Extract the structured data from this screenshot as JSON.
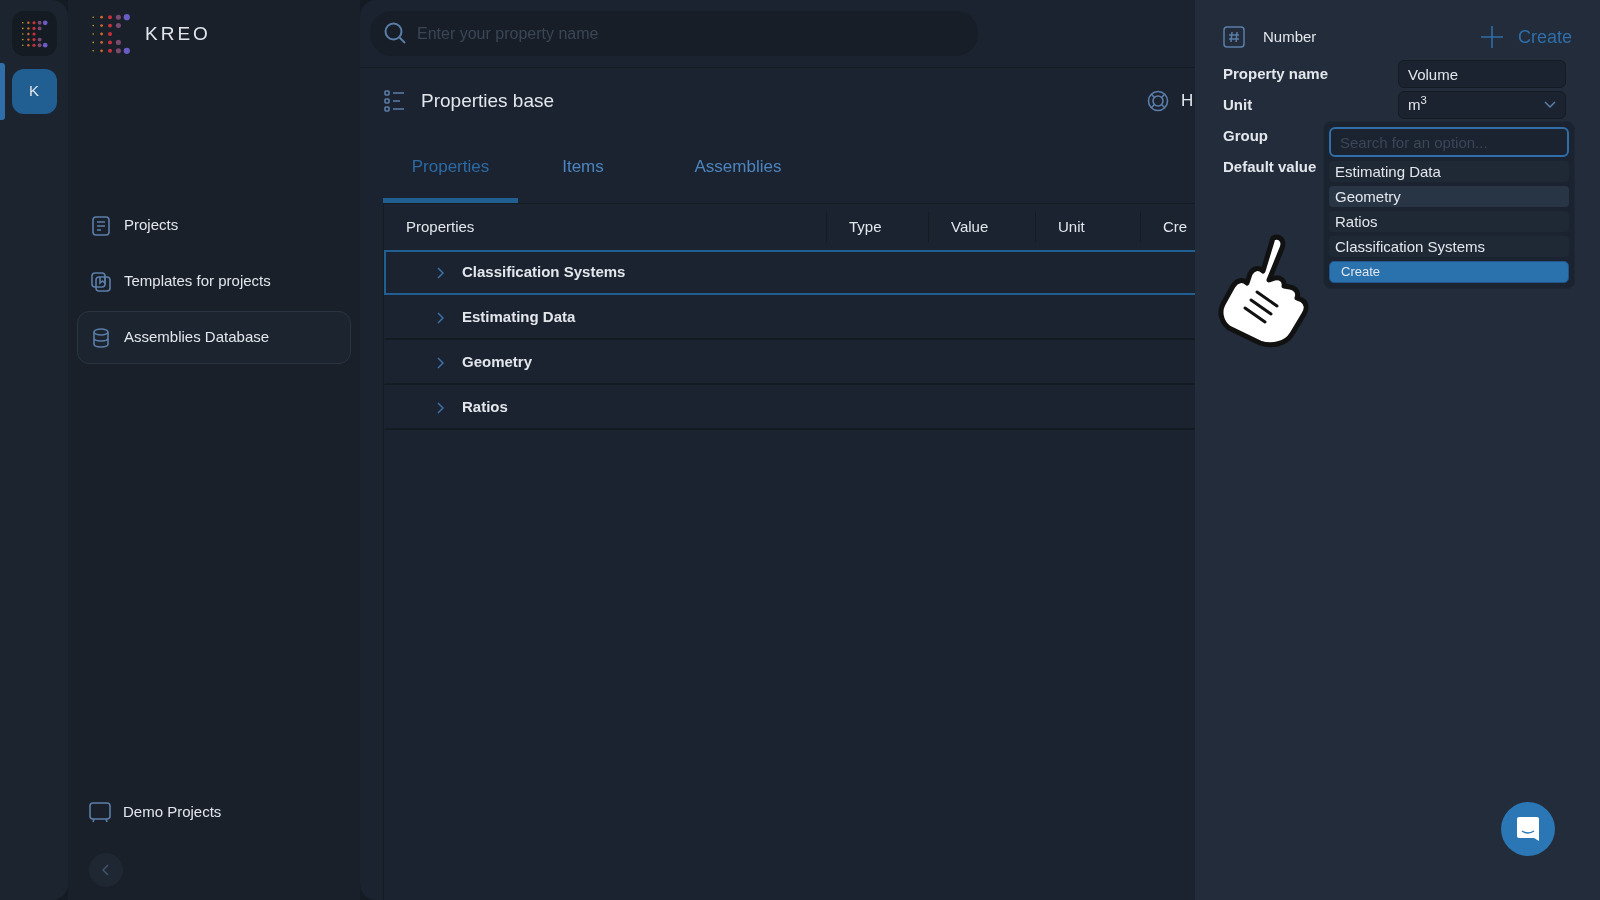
{
  "rail": {
    "account": {
      "initial": "K",
      "selected": true
    }
  },
  "brand": {
    "name": "KREO"
  },
  "sidebar": {
    "items": [
      {
        "label": "Projects",
        "selected": false
      },
      {
        "label": "Templates for projects",
        "selected": false
      },
      {
        "label": "Assemblies Database",
        "selected": true
      }
    ],
    "bottom_item": {
      "label": "Demo Projects"
    }
  },
  "search": {
    "placeholder": "Enter your property name"
  },
  "page": {
    "title": "Properties base",
    "help_label": "H"
  },
  "tabs": [
    {
      "label": "Properties",
      "selected": true
    },
    {
      "label": "Items",
      "selected": false
    },
    {
      "label": "Assemblies",
      "selected": false
    }
  ],
  "table": {
    "columns": [
      "Properties",
      "Type",
      "Value",
      "Unit",
      "Cre"
    ],
    "rows": [
      {
        "name": "Classification Systems",
        "selected": true
      },
      {
        "name": "Estimating Data",
        "selected": false
      },
      {
        "name": "Geometry",
        "selected": false
      },
      {
        "name": "Ratios",
        "selected": false
      }
    ]
  },
  "panel": {
    "type_label": "Number",
    "create_label": "Create",
    "fields": [
      {
        "label": "Property name",
        "kind": "text",
        "value": "Volume"
      },
      {
        "label": "Unit",
        "kind": "select",
        "value": "m$^{3}$"
      },
      {
        "label": "Group",
        "kind": "combo"
      },
      {
        "label": "Default value",
        "kind": "none"
      }
    ],
    "dropdown": {
      "placeholder": "Search for an option...",
      "options": [
        {
          "label": "Estimating Data",
          "highlighted": false
        },
        {
          "label": "Geometry",
          "highlighted": true
        },
        {
          "label": "Ratios",
          "highlighted": false
        },
        {
          "label": "Classification Systems",
          "highlighted": false
        }
      ],
      "create_label": "Create"
    }
  }
}
